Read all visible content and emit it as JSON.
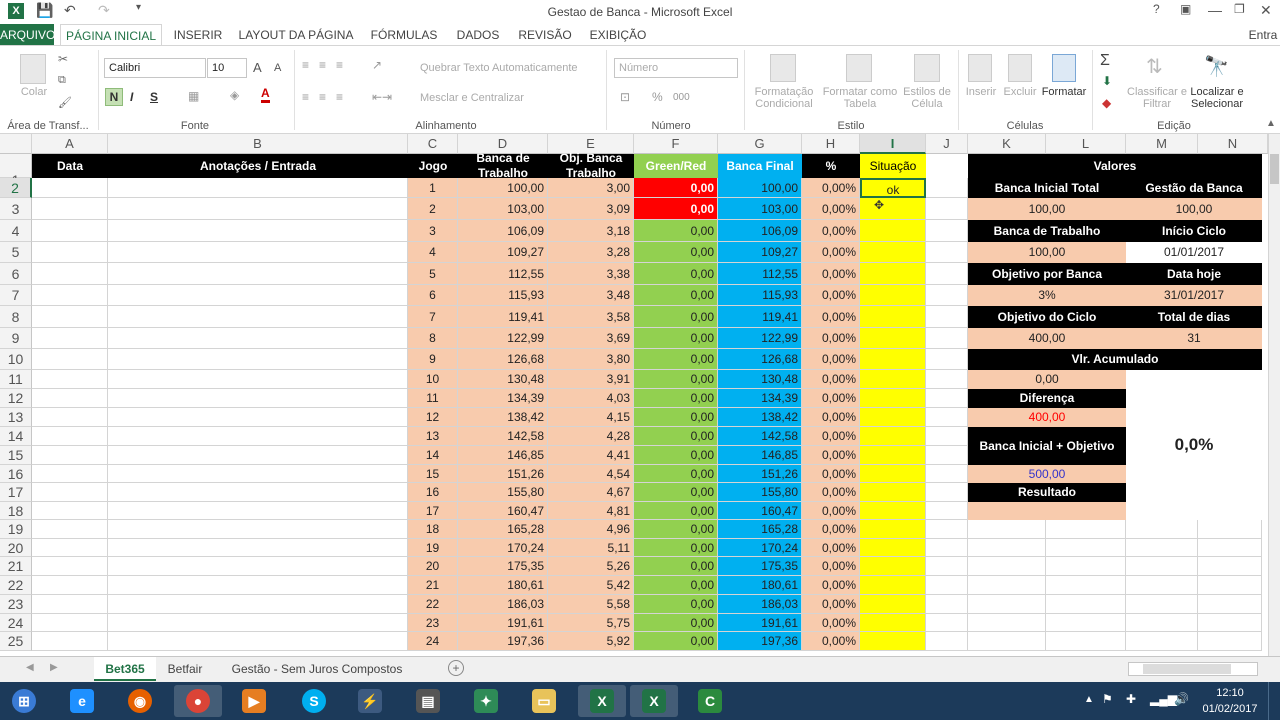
{
  "window": {
    "title": "Gestao de Banca - Microsoft Excel",
    "user": "Entra"
  },
  "tabs": [
    "ARQUIVO",
    "PÁGINA INICIAL",
    "INSERIR",
    "LAYOUT DA PÁGINA",
    "FÓRMULAS",
    "DADOS",
    "REVISÃO",
    "EXIBIÇÃO"
  ],
  "ribbon": {
    "paste": "Colar",
    "clipboard": "Área de Transf...",
    "font_name": "Calibri",
    "font_size": "10",
    "font_group": "Fonte",
    "wrap": "Quebrar Texto Automaticamente",
    "merge": "Mesclar e Centralizar",
    "align_group": "Alinhamento",
    "number_format": "Número",
    "number_group": "Número",
    "cond_format": "Formatação Condicional",
    "format_table": "Formatar como Tabela",
    "cell_styles": "Estilos de Célula",
    "styles_group": "Estilo",
    "insert": "Inserir",
    "delete": "Excluir",
    "format": "Formatar",
    "cells_group": "Células",
    "sort": "Classificar e Filtrar",
    "find": "Localizar e Selecionar",
    "edit_group": "Edição",
    "bold": "N",
    "italic": "I",
    "underline": "S",
    "grow": "A",
    "shrink": "A",
    "percent": "%",
    "thousands": "000"
  },
  "columns": [
    "A",
    "B",
    "C",
    "D",
    "E",
    "F",
    "G",
    "H",
    "I",
    "J",
    "K",
    "L",
    "M",
    "N"
  ],
  "headers": {
    "data": "Data",
    "anot": "Anotações / Entrada",
    "jogo": "Jogo",
    "banca": "Banca de Trabalho",
    "obj": "Obj. Banca Trabalho",
    "green": "Green/Red",
    "final": "Banca Final",
    "pct": "%",
    "sit": "Situação",
    "valores": "Valores"
  },
  "rows": [
    {
      "jogo": "1",
      "banca": "100,00",
      "obj": "3,00",
      "gr": "0,00",
      "final": "100,00",
      "pct": "0,00%",
      "sit": "ok"
    },
    {
      "jogo": "2",
      "banca": "103,00",
      "obj": "3,09",
      "gr": "0,00",
      "final": "103,00",
      "pct": "0,00%",
      "sit": ""
    },
    {
      "jogo": "3",
      "banca": "106,09",
      "obj": "3,18",
      "gr": "0,00",
      "final": "106,09",
      "pct": "0,00%",
      "sit": ""
    },
    {
      "jogo": "4",
      "banca": "109,27",
      "obj": "3,28",
      "gr": "0,00",
      "final": "109,27",
      "pct": "0,00%",
      "sit": ""
    },
    {
      "jogo": "5",
      "banca": "112,55",
      "obj": "3,38",
      "gr": "0,00",
      "final": "112,55",
      "pct": "0,00%",
      "sit": ""
    },
    {
      "jogo": "6",
      "banca": "115,93",
      "obj": "3,48",
      "gr": "0,00",
      "final": "115,93",
      "pct": "0,00%",
      "sit": ""
    },
    {
      "jogo": "7",
      "banca": "119,41",
      "obj": "3,58",
      "gr": "0,00",
      "final": "119,41",
      "pct": "0,00%",
      "sit": ""
    },
    {
      "jogo": "8",
      "banca": "122,99",
      "obj": "3,69",
      "gr": "0,00",
      "final": "122,99",
      "pct": "0,00%",
      "sit": ""
    },
    {
      "jogo": "9",
      "banca": "126,68",
      "obj": "3,80",
      "gr": "0,00",
      "final": "126,68",
      "pct": "0,00%",
      "sit": ""
    },
    {
      "jogo": "10",
      "banca": "130,48",
      "obj": "3,91",
      "gr": "0,00",
      "final": "130,48",
      "pct": "0,00%",
      "sit": ""
    },
    {
      "jogo": "11",
      "banca": "134,39",
      "obj": "4,03",
      "gr": "0,00",
      "final": "134,39",
      "pct": "0,00%",
      "sit": ""
    },
    {
      "jogo": "12",
      "banca": "138,42",
      "obj": "4,15",
      "gr": "0,00",
      "final": "138,42",
      "pct": "0,00%",
      "sit": ""
    },
    {
      "jogo": "13",
      "banca": "142,58",
      "obj": "4,28",
      "gr": "0,00",
      "final": "142,58",
      "pct": "0,00%",
      "sit": ""
    },
    {
      "jogo": "14",
      "banca": "146,85",
      "obj": "4,41",
      "gr": "0,00",
      "final": "146,85",
      "pct": "0,00%",
      "sit": ""
    },
    {
      "jogo": "15",
      "banca": "151,26",
      "obj": "4,54",
      "gr": "0,00",
      "final": "151,26",
      "pct": "0,00%",
      "sit": ""
    },
    {
      "jogo": "16",
      "banca": "155,80",
      "obj": "4,67",
      "gr": "0,00",
      "final": "155,80",
      "pct": "0,00%",
      "sit": ""
    },
    {
      "jogo": "17",
      "banca": "160,47",
      "obj": "4,81",
      "gr": "0,00",
      "final": "160,47",
      "pct": "0,00%",
      "sit": ""
    },
    {
      "jogo": "18",
      "banca": "165,28",
      "obj": "4,96",
      "gr": "0,00",
      "final": "165,28",
      "pct": "0,00%",
      "sit": ""
    },
    {
      "jogo": "19",
      "banca": "170,24",
      "obj": "5,11",
      "gr": "0,00",
      "final": "170,24",
      "pct": "0,00%",
      "sit": ""
    },
    {
      "jogo": "20",
      "banca": "175,35",
      "obj": "5,26",
      "gr": "0,00",
      "final": "175,35",
      "pct": "0,00%",
      "sit": ""
    },
    {
      "jogo": "21",
      "banca": "180,61",
      "obj": "5,42",
      "gr": "0,00",
      "final": "180,61",
      "pct": "0,00%",
      "sit": ""
    },
    {
      "jogo": "22",
      "banca": "186,03",
      "obj": "5,58",
      "gr": "0,00",
      "final": "186,03",
      "pct": "0,00%",
      "sit": ""
    },
    {
      "jogo": "23",
      "banca": "191,61",
      "obj": "5,75",
      "gr": "0,00",
      "final": "191,61",
      "pct": "0,00%",
      "sit": ""
    },
    {
      "jogo": "24",
      "banca": "197,36",
      "obj": "5,92",
      "gr": "0,00",
      "final": "197,36",
      "pct": "0,00%",
      "sit": ""
    }
  ],
  "panel": {
    "banca_inicial_label": "Banca Inicial Total",
    "banca_inicial": "100,00",
    "gestao_label": "Gestão da Banca",
    "gestao": "100,00",
    "banca_trab_label": "Banca de Trabalho",
    "banca_trab": "100,00",
    "inicio_label": "Início Ciclo",
    "inicio": "01/01/2017",
    "obj_banca_label": "Objetivo por Banca",
    "obj_banca": "3%",
    "data_hoje_label": "Data hoje",
    "data_hoje": "31/01/2017",
    "obj_ciclo_label": "Objetivo do Ciclo",
    "obj_ciclo": "400,00",
    "total_dias_label": "Total de dias",
    "total_dias": "31",
    "vlr_acum_label": "Vlr. Acumulado",
    "vlr_acum": "0,00",
    "diferenca_label": "Diferença",
    "diferenca": "400,00",
    "bio_label": "Banca Inicial + Objetivo",
    "bio": "500,00",
    "resultado_label": "Resultado",
    "pct_result": "0,0%"
  },
  "colors": {
    "red": "#ff0000",
    "blue_value": "#3333cc"
  },
  "sheets": [
    "Bet365",
    "Betfair",
    "Gestão - Sem Juros Compostos"
  ],
  "clock": {
    "time": "12:10",
    "date": "01/02/2017"
  }
}
